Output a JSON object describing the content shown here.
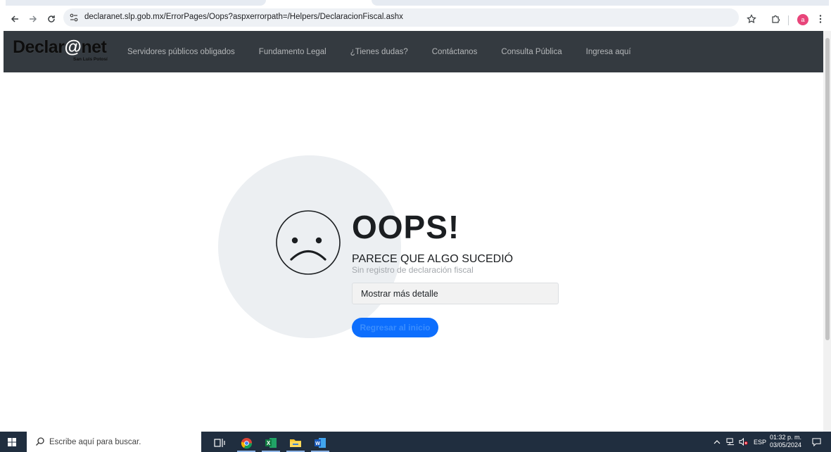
{
  "browser": {
    "url": "declaranet.slp.gob.mx/ErrorPages/Oops?aspxerrorpath=/Helpers/DeclaracionFiscal.ashx",
    "profile_initial": "a"
  },
  "site": {
    "logo_text_a": "Declar",
    "logo_text_at": "@",
    "logo_text_b": "net",
    "logo_subtitle": "San Luis Potosí",
    "menu": [
      {
        "label": "Servidores públicos obligados"
      },
      {
        "label": "Fundamento Legal"
      },
      {
        "label": "¿Tienes dudas?"
      },
      {
        "label": "Contáctanos"
      },
      {
        "label": "Consulta Pública"
      },
      {
        "label": "Ingresa aquí"
      }
    ]
  },
  "error": {
    "title": "OOPS!",
    "subtitle": "PARECE QUE ALGO SUCEDIÓ",
    "message": "Sin registro de declaración fiscal",
    "more_details_label": "Mostrar más detalle",
    "home_button_label": "Regresar al inicio"
  },
  "taskbar": {
    "search_placeholder": "Escribe aquí para buscar.",
    "language": "ESP",
    "time": "01:32 p. m.",
    "date": "03/05/2024"
  },
  "colors": {
    "navbar": "#343a40",
    "primary_button": "#0d6efd",
    "circle_bg": "#eceff2",
    "taskbar": "#202e3f"
  }
}
